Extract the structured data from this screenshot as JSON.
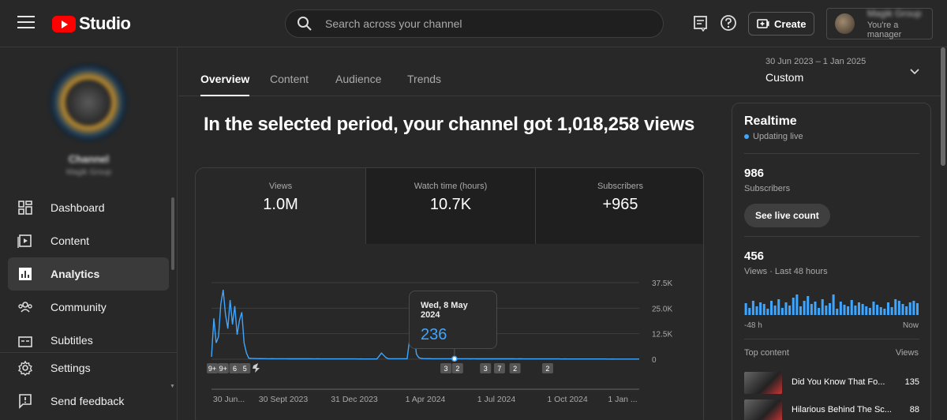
{
  "header": {
    "app_name": "Studio",
    "search_placeholder": "Search across your channel",
    "create_label": "Create",
    "account_name": "Magik Group",
    "account_role": "You're a manager"
  },
  "sidebar": {
    "channel_name": "Channel",
    "channel_subtitle": "Magik Group",
    "items": [
      {
        "label": "Dashboard"
      },
      {
        "label": "Content"
      },
      {
        "label": "Analytics"
      },
      {
        "label": "Community"
      },
      {
        "label": "Subtitles"
      },
      {
        "label": "Settings"
      },
      {
        "label": "Send feedback"
      }
    ]
  },
  "tabs": [
    {
      "label": "Overview"
    },
    {
      "label": "Content"
    },
    {
      "label": "Audience"
    },
    {
      "label": "Trends"
    }
  ],
  "date_range": {
    "range": "30 Jun 2023 – 1 Jan 2025",
    "preset": "Custom"
  },
  "headline": "In the selected period, your channel got 1,018,258 views",
  "metrics": [
    {
      "label": "Views",
      "value": "1.0M"
    },
    {
      "label": "Watch time (hours)",
      "value": "10.7K"
    },
    {
      "label": "Subscribers",
      "value": "+965"
    }
  ],
  "tooltip": {
    "date": "Wed, 8 May 2024",
    "value": "236"
  },
  "chart_data": {
    "type": "line",
    "title": "",
    "x_tick_labels": [
      "30 Jun...",
      "30 Sept 2023",
      "31 Dec 2023",
      "1 Apr 2024",
      "1 Jul 2024",
      "1 Oct 2024",
      "1 Jan ..."
    ],
    "y_tick_labels": [
      "37.5K",
      "25.0K",
      "12.5K",
      "0"
    ],
    "ylim": [
      0,
      37500
    ],
    "line_color": "#3ea6ff",
    "series": [
      {
        "name": "",
        "x_start": "2023-06-30",
        "step_days": 3,
        "values": [
          1200,
          20000,
          8000,
          11000,
          27000,
          34000,
          22000,
          15000,
          29000,
          17000,
          26000,
          12000,
          19000,
          23000,
          8000,
          3000,
          500,
          400,
          350,
          300,
          280,
          300,
          280,
          260,
          250,
          240,
          260,
          250,
          240,
          230,
          220,
          230,
          220,
          210,
          200,
          210,
          200,
          200,
          190,
          200,
          190,
          185,
          180,
          175,
          170,
          180,
          175,
          170,
          160,
          170,
          165,
          160,
          155,
          160,
          150,
          155,
          150,
          145,
          140,
          150,
          145,
          140,
          138,
          135,
          140,
          135,
          130,
          132,
          130,
          128,
          130,
          125,
          1500,
          3000,
          1800,
          700,
          236,
          230,
          240,
          250,
          230,
          220,
          230,
          220,
          240,
          9000,
          30000,
          12000,
          2500,
          800,
          400,
          300,
          280,
          260,
          270,
          250,
          240,
          250,
          245,
          240,
          235,
          230,
          240,
          235,
          230,
          225,
          220,
          230,
          225,
          220,
          215,
          210,
          220,
          215,
          210,
          205,
          200,
          210,
          205,
          200,
          195,
          190,
          200,
          195,
          190,
          185,
          180,
          190,
          185,
          180,
          175,
          170,
          180,
          175,
          170,
          165,
          160,
          170,
          165,
          160,
          155,
          150,
          160,
          155,
          150,
          145,
          140,
          150,
          145,
          140,
          135,
          130,
          140,
          135,
          130,
          125,
          120,
          130,
          125,
          120,
          115,
          110,
          120,
          115,
          110,
          105,
          100,
          110,
          105,
          100,
          95,
          90,
          100,
          95,
          90,
          85,
          80,
          90,
          85,
          80,
          75,
          70,
          80,
          75,
          70,
          65
        ]
      }
    ],
    "markers": [
      {
        "label": "9+",
        "date": "2023-07-01"
      },
      {
        "label": "9+",
        "date": "2023-07-15"
      },
      {
        "label": "6",
        "date": "2023-07-30"
      },
      {
        "label": "5",
        "date": "2023-08-12"
      },
      {
        "label": "shorts",
        "date": "2023-08-26"
      },
      {
        "label": "3",
        "date": "2024-04-27"
      },
      {
        "label": "2",
        "date": "2024-05-12"
      },
      {
        "label": "3",
        "date": "2024-06-17"
      },
      {
        "label": "7",
        "date": "2024-07-05"
      },
      {
        "label": "2",
        "date": "2024-07-25"
      },
      {
        "label": "2",
        "date": "2024-09-05"
      }
    ]
  },
  "realtime": {
    "title": "Realtime",
    "status": "Updating live",
    "subscribers_value": "986",
    "subscribers_label": "Subscribers",
    "see_live_label": "See live count",
    "views_value": "456",
    "views_label": "Views · Last 48 hours",
    "axis_start": "-48 h",
    "axis_end": "Now",
    "bar_values": [
      15,
      9,
      18,
      11,
      16,
      14,
      8,
      18,
      12,
      20,
      9,
      16,
      12,
      22,
      26,
      11,
      18,
      24,
      14,
      17,
      9,
      20,
      12,
      15,
      26,
      8,
      17,
      13,
      11,
      19,
      12,
      16,
      14,
      11,
      9,
      17,
      13,
      10,
      8,
      16,
      10,
      20,
      18,
      14,
      11,
      16,
      18,
      15
    ],
    "top_content_label": "Top content",
    "views_column_label": "Views",
    "top_content": [
      {
        "title": "Did You Know That Fo...",
        "views": "135"
      },
      {
        "title": "Hilarious Behind The Sc...",
        "views": "88"
      }
    ]
  }
}
